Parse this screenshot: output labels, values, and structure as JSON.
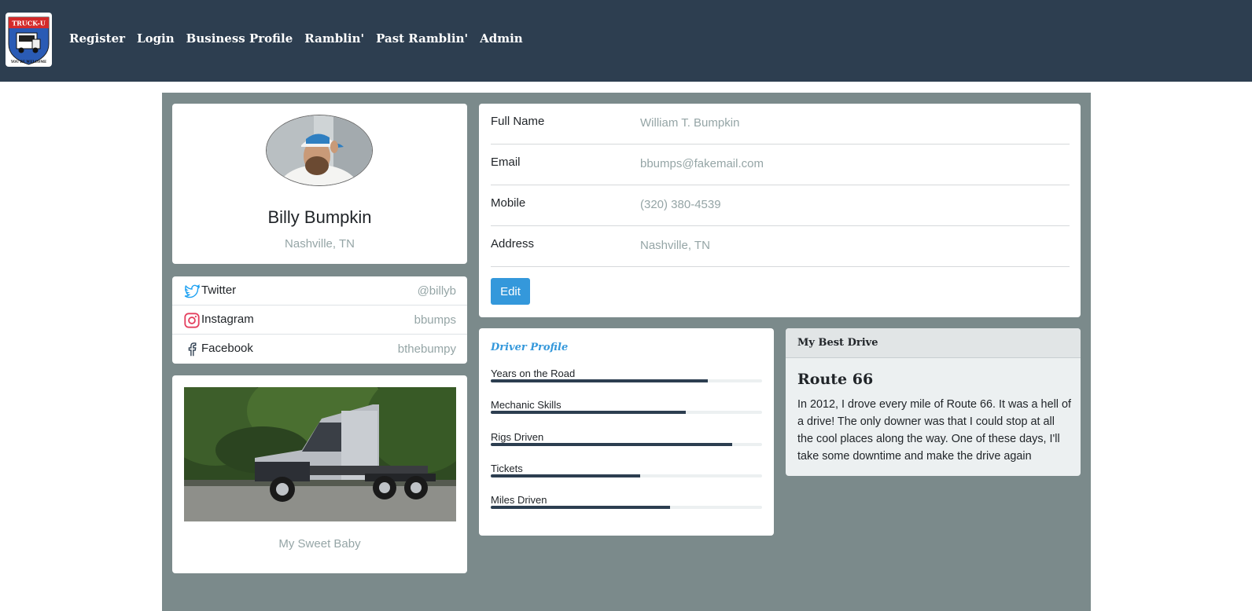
{
  "navbar": {
    "logo_text_top": "TRUCK-U",
    "logo_text_bottom": "YOU'RE WELCOME",
    "links": [
      "Register",
      "Login",
      "Business Profile",
      "Ramblin'",
      "Past Ramblin'",
      "Admin"
    ]
  },
  "profile": {
    "name": "Billy Bumpkin",
    "location": "Nashville, TN"
  },
  "social": [
    {
      "icon": "twitter-icon",
      "label": "Twitter",
      "value": "@billyb",
      "color": "#1da1f2"
    },
    {
      "icon": "instagram-icon",
      "label": "Instagram",
      "value": "bbumps",
      "color": "#e4405f"
    },
    {
      "icon": "facebook-icon",
      "label": "Facebook",
      "value": "bthebumpy",
      "color": "#2d3e50"
    }
  ],
  "truck": {
    "caption": "My Sweet Baby"
  },
  "info": {
    "rows": [
      {
        "label": "Full Name",
        "value": "William T. Bumpkin"
      },
      {
        "label": "Email",
        "value": "bbumps@fakemail.com"
      },
      {
        "label": "Mobile",
        "value": "(320) 380-4539"
      },
      {
        "label": "Address",
        "value": "Nashville, TN"
      }
    ],
    "edit_label": "Edit"
  },
  "driver_profile": {
    "title": "Driver Profile",
    "skills": [
      {
        "label": "Years on the Road",
        "percent": 80
      },
      {
        "label": "Mechanic Skills",
        "percent": 72
      },
      {
        "label": "Rigs Driven",
        "percent": 89
      },
      {
        "label": "Tickets",
        "percent": 55
      },
      {
        "label": "Miles Driven",
        "percent": 66
      }
    ]
  },
  "best_drive": {
    "header": "My Best Drive",
    "title": "Route 66",
    "text": "In 2012, I drove every mile of Route 66. It was a hell of a drive! The only downer was that I could stop at all the cool places along the way. One of these days, I'll take some downtime and make the drive again"
  },
  "colors": {
    "navbar": "#2d3e50",
    "panel": "#7b8a8b",
    "accent": "#3498db",
    "muted": "#95a5a6"
  }
}
